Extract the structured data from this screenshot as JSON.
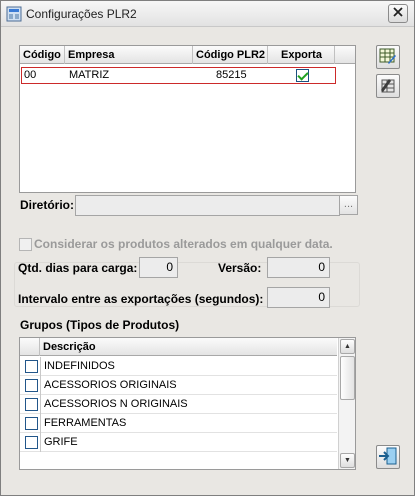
{
  "window": {
    "title": "Configurações PLR2"
  },
  "plr_grid": {
    "columns": [
      "Código",
      "Empresa",
      "Código PLR2",
      "Exporta"
    ],
    "rows": [
      {
        "codigo": "00",
        "empresa": "MATRIZ",
        "codigo_plr2": "85215",
        "exporta": true
      }
    ]
  },
  "side_buttons": {
    "top_icon": "grid-edit-icon",
    "second_icon": "grid-refresh-icon",
    "exit_icon": "exit-door-icon"
  },
  "diretorio": {
    "label": "Diretório:",
    "value": "",
    "browse_label": "..."
  },
  "considerar": {
    "label": "Considerar os produtos alterados em qualquer data.",
    "checked": false
  },
  "qtd_dias": {
    "label": "Qtd. dias para carga:",
    "value": "0"
  },
  "versao": {
    "label": "Versão:",
    "value": "0"
  },
  "intervalo": {
    "label": "Intervalo entre as exportações (segundos):",
    "value": "0"
  },
  "grupos": {
    "title": "Grupos (Tipos de Produtos)",
    "column": "Descrição",
    "items": [
      {
        "label": "INDEFINIDOS",
        "checked": false
      },
      {
        "label": "ACESSORIOS ORIGINAIS",
        "checked": false
      },
      {
        "label": "ACESSORIOS N ORIGINAIS",
        "checked": false
      },
      {
        "label": "FERRAMENTAS",
        "checked": false
      },
      {
        "label": "GRIFE",
        "checked": false
      }
    ]
  },
  "colors": {
    "accent_row_border": "#cc2a2a",
    "check_mark": "#21a121"
  }
}
